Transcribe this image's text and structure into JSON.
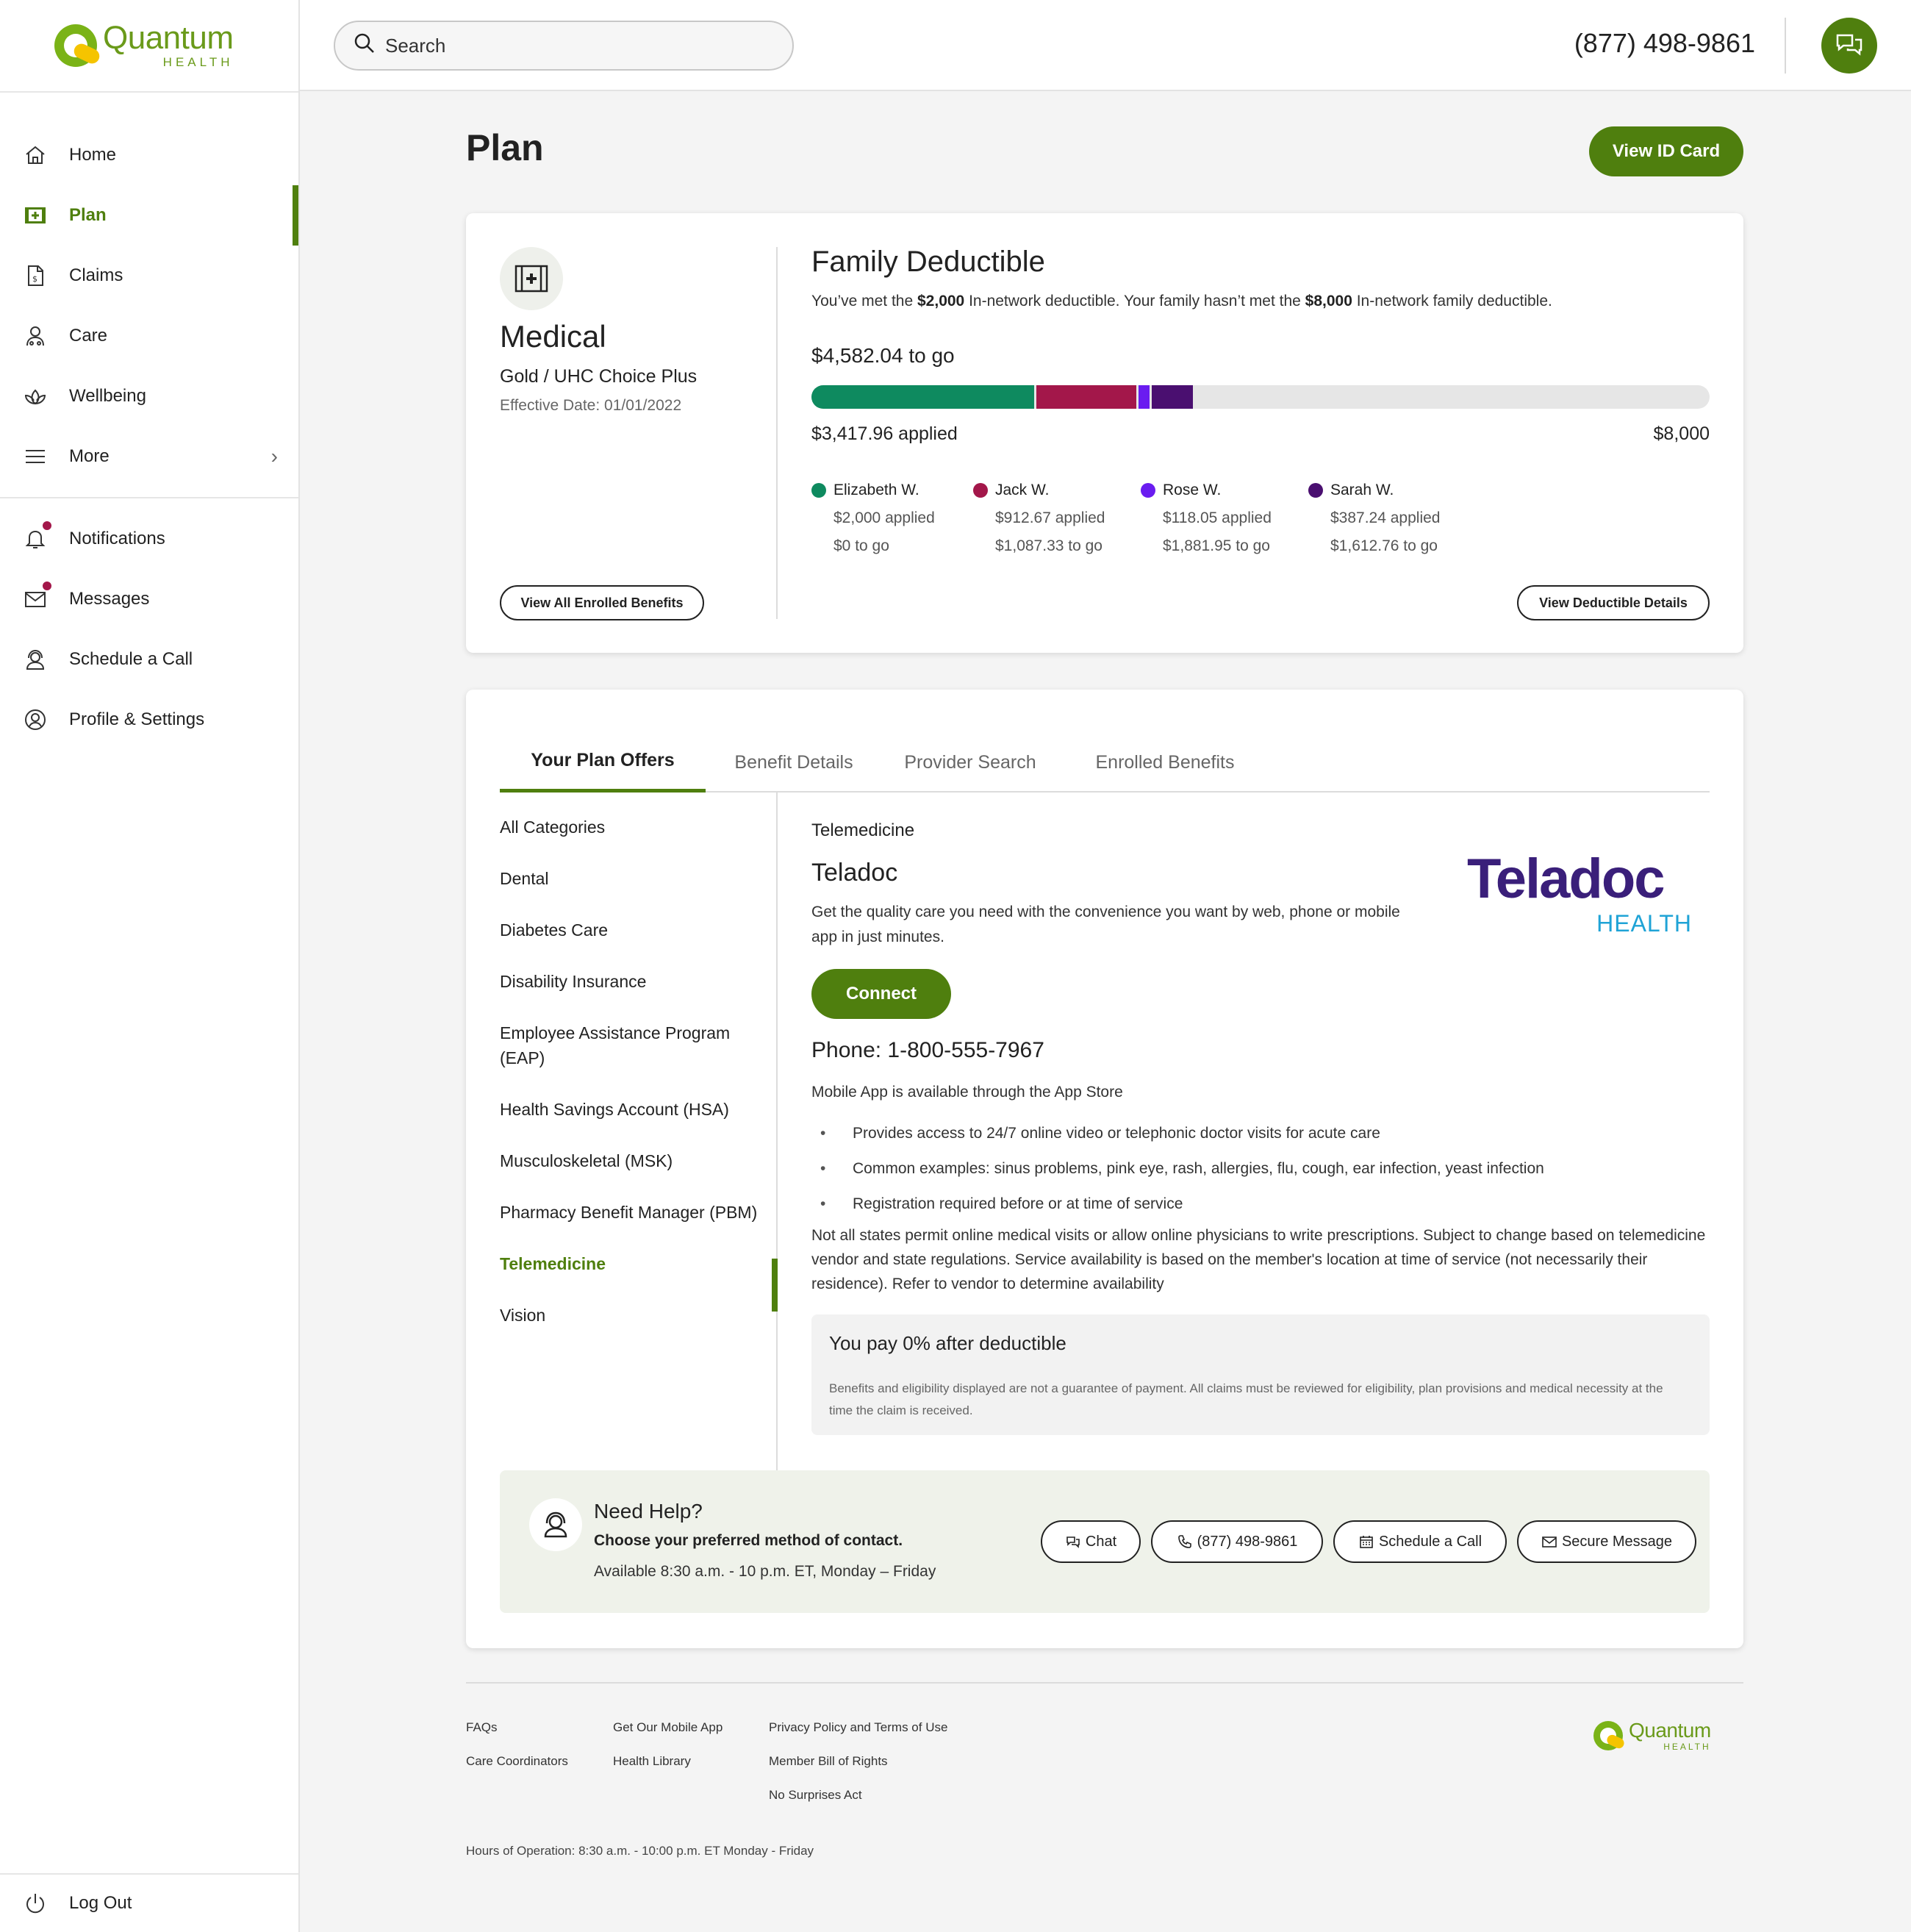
{
  "brand": {
    "name": "Quantum",
    "sub": "HEALTH",
    "color": "#4f7f0e"
  },
  "sidebar": {
    "items": [
      {
        "label": "Home",
        "icon": "home-icon"
      },
      {
        "label": "Plan",
        "icon": "medical-card-icon",
        "active": true
      },
      {
        "label": "Claims",
        "icon": "claims-icon"
      },
      {
        "label": "Care",
        "icon": "care-icon"
      },
      {
        "label": "Wellbeing",
        "icon": "lotus-icon"
      },
      {
        "label": "More",
        "icon": "menu-icon"
      }
    ],
    "secondary": [
      {
        "label": "Notifications",
        "icon": "bell-icon",
        "badge": true
      },
      {
        "label": "Messages",
        "icon": "envelope-icon",
        "badge": true
      },
      {
        "label": "Schedule a Call",
        "icon": "headset-icon"
      },
      {
        "label": "Profile & Settings",
        "icon": "user-circle-icon"
      }
    ],
    "logout": "Log Out"
  },
  "header": {
    "search_placeholder": "Search",
    "phone": "(877) 498-9861"
  },
  "page": {
    "title": "Plan",
    "view_id_card": "View ID Card"
  },
  "plan_card": {
    "type": "Medical",
    "plan_name": "Gold / UHC Choice Plus",
    "effective": "Effective Date: 01/01/2022",
    "view_all": "View All Enrolled Benefits"
  },
  "deductible": {
    "title": "Family Deductible",
    "desc_1": "You’ve met the ",
    "desc_b1": "$2,000",
    "desc_2": " In-network deductible. Your family hasn’t met the ",
    "desc_b2": "$8,000",
    "desc_3": " In-network family deductible.",
    "to_go": "$4,582.04 to go",
    "applied": "$3,417.96 applied",
    "max": "$8,000",
    "max_value": 8000,
    "members": [
      {
        "name": "Elizabeth W.",
        "applied": "$2,000 applied",
        "to_go": "$0 to go",
        "value": 2000,
        "color": "#0e8a5f"
      },
      {
        "name": "Jack W.",
        "applied": "$912.67 applied",
        "to_go": "$1,087.33 to go",
        "value": 912.67,
        "color": "#a3174a"
      },
      {
        "name": "Rose W.",
        "applied": "$118.05 applied",
        "to_go": "$1,881.95 to go",
        "value": 118.05,
        "color": "#6a1cf0"
      },
      {
        "name": "Sarah W.",
        "applied": "$387.24 applied",
        "to_go": "$1,612.76 to go",
        "value": 387.24,
        "color": "#4a0f70"
      }
    ],
    "view_details": "View Deductible Details"
  },
  "tabs": [
    "Your Plan Offers",
    "Benefit Details",
    "Provider Search",
    "Enrolled Benefits"
  ],
  "categories": [
    "All Categories",
    "Dental",
    "Diabetes Care",
    "Disability Insurance",
    "Employee Assistance Program (EAP)",
    "Health Savings Account (HSA)",
    "Musculoskeletal (MSK)",
    "Pharmacy Benefit Manager (PBM)",
    "Telemedicine",
    "Vision"
  ],
  "offer": {
    "category": "Telemedicine",
    "name": "Teladoc",
    "description": "Get the quality care you need with the convenience you want by web, phone or mobile app in just minutes.",
    "connect": "Connect",
    "phone": "Phone: 1-800-555-7967",
    "app_note": "Mobile App is available through the App Store",
    "bullets": [
      "Provides access to 24/7 online video or telephonic doctor visits for acute care",
      "Common examples: sinus problems, pink eye, rash, allergies, flu, cough, ear infection, yeast infection",
      "Registration required before or at time of service"
    ],
    "note": "Not all states permit online medical visits or allow online physicians to write prescriptions. Subject to change based on telemedicine vendor and state regulations. Service availability is based on the member's location at time of service (not necessarily their residence). Refer to vendor to determine availability",
    "pay": "You pay 0% after deductible",
    "fine_print": "Benefits and eligibility displayed are not a guarantee of payment. All claims must be reviewed for eligibility, plan provisions and medical necessity at the time the claim is received.",
    "logo_name": "Teladoc",
    "logo_sub": "HEALTH"
  },
  "help": {
    "title": "Need Help?",
    "subtitle": "Choose your preferred method of contact.",
    "hours": "Available 8:30 a.m. - 10 p.m. ET, Monday – Friday",
    "chat": "Chat",
    "phone": "(877) 498-9861",
    "schedule": "Schedule a Call",
    "message": "Secure Message"
  },
  "footer": {
    "col1": [
      "FAQs",
      "Care Coordinators"
    ],
    "col2": [
      "Get Our Mobile App",
      "Health Library"
    ],
    "col3": [
      "Privacy Policy and Terms of Use",
      "Member Bill of Rights",
      "No Surprises Act"
    ],
    "hours": "Hours of Operation: 8:30 a.m. - 10:00 p.m. ET Monday - Friday"
  }
}
